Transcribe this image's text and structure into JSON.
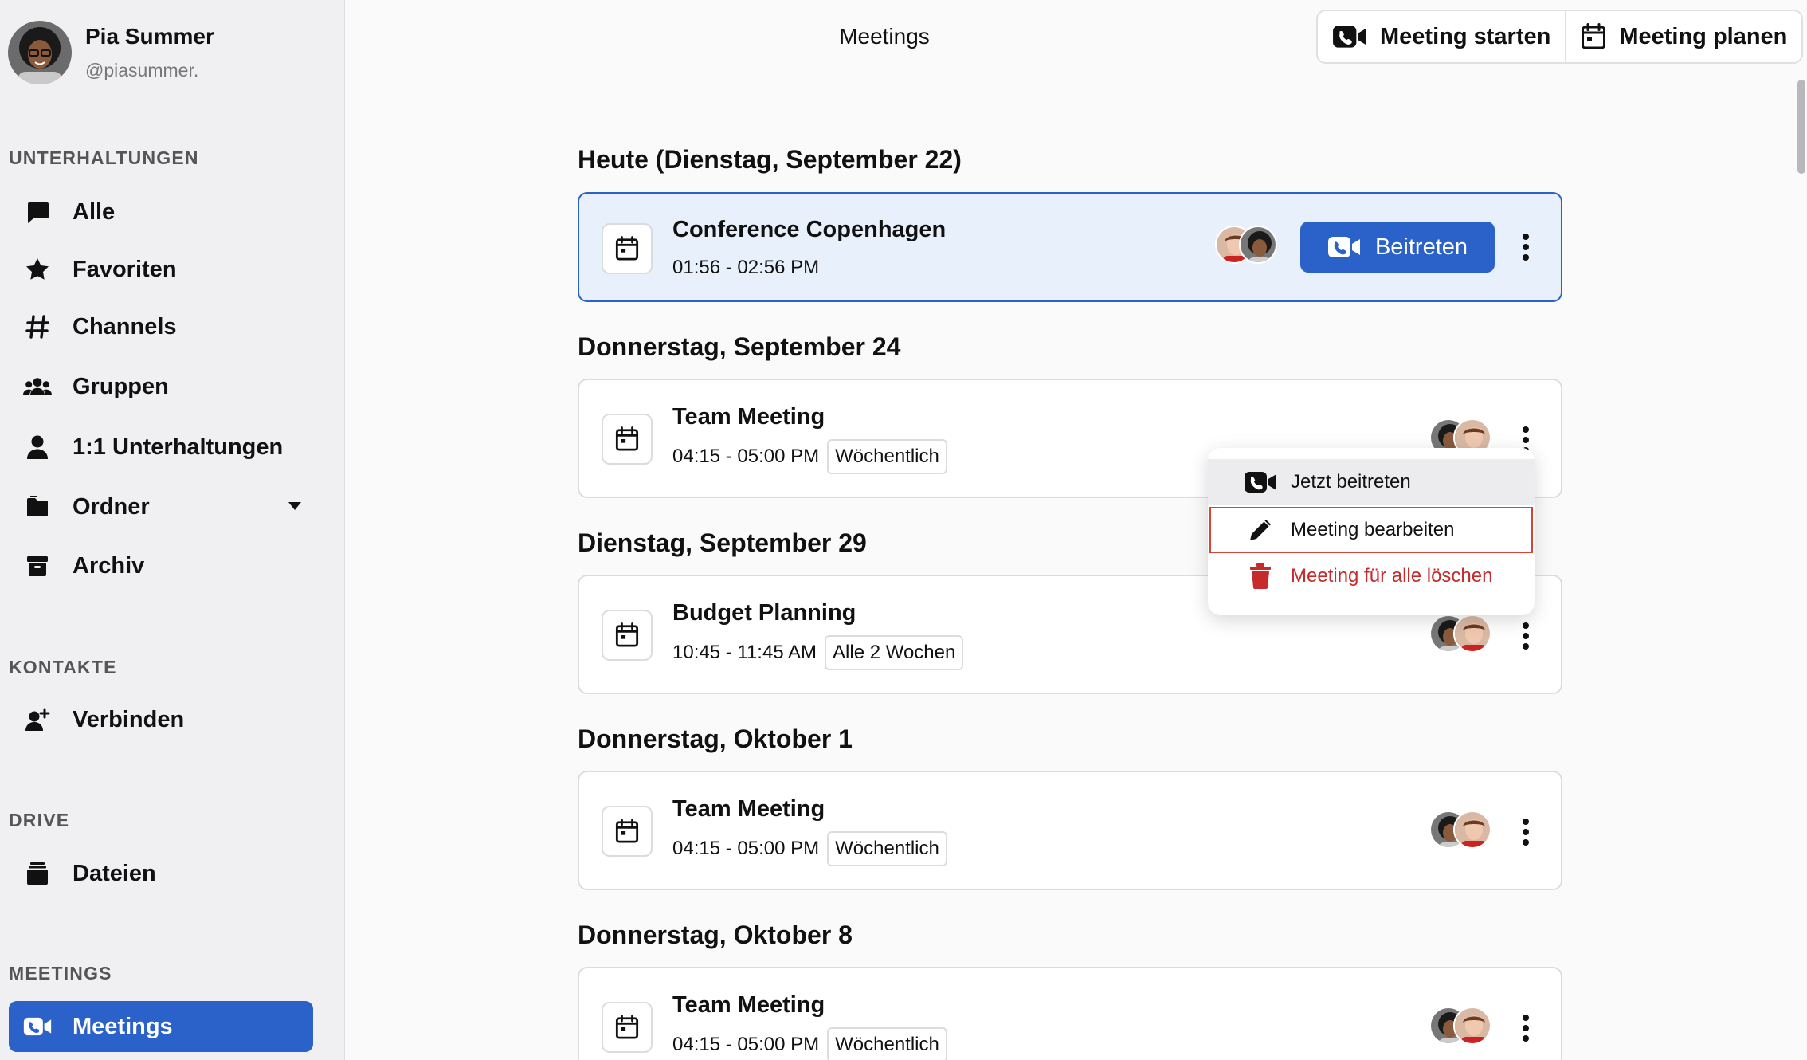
{
  "user": {
    "name": "Pia Summer",
    "handle": "@piasummer."
  },
  "sections": {
    "conversations": "UNTERHALTUNGEN",
    "contacts": "KONTAKTE",
    "drive": "DRIVE",
    "meetings": "MEETINGS"
  },
  "nav": {
    "all": "Alle",
    "favorites": "Favoriten",
    "channels": "Channels",
    "groups": "Gruppen",
    "one_on_one": "1:1 Unterhaltungen",
    "folders": "Ordner",
    "archive": "Archiv",
    "connect": "Verbinden",
    "files": "Dateien",
    "meetings": "Meetings"
  },
  "header": {
    "title": "Meetings",
    "start_meeting": "Meeting starten",
    "plan_meeting": "Meeting planen"
  },
  "days": [
    {
      "heading": "Heute (Dienstag, September 22)",
      "title": "Conference Copenhagen",
      "time": "01:56 - 02:56 PM",
      "badge": "",
      "join_label": "Beitreten"
    },
    {
      "heading": "Donnerstag, September 24",
      "title": "Team Meeting",
      "time": "04:15 - 05:00 PM",
      "badge": "Wöchentlich"
    },
    {
      "heading": "Dienstag, September 29",
      "title": "Budget Planning",
      "time": "10:45 - 11:45 AM",
      "badge": "Alle 2 Wochen"
    },
    {
      "heading": "Donnerstag, Oktober 1",
      "title": "Team Meeting",
      "time": "04:15 - 05:00 PM",
      "badge": "Wöchentlich"
    },
    {
      "heading": "Donnerstag, Oktober 8",
      "title": "Team Meeting",
      "time": "04:15 - 05:00 PM",
      "badge": "Wöchentlich"
    }
  ],
  "menu": {
    "join_now": "Jetzt beitreten",
    "edit": "Meeting bearbeiten",
    "delete_all": "Meeting für alle löschen"
  },
  "colors": {
    "accent": "#2a62c9",
    "danger": "#c62a2a",
    "focus_outline": "#d64533"
  }
}
